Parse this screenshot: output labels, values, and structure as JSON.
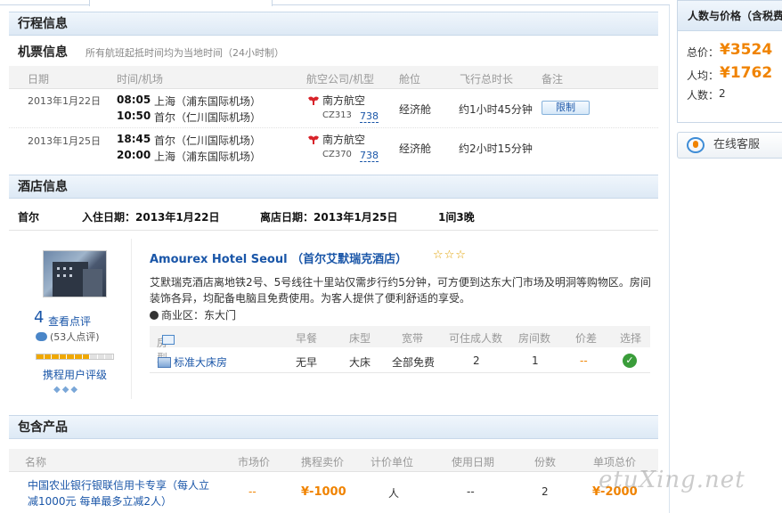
{
  "itinerary": {
    "section_title": "行程信息",
    "flight_title": "机票信息",
    "flight_note": "所有航班起抵时间均为当地时间（24小时制）",
    "columns": [
      "日期",
      "时间/机场",
      "航空公司/机型",
      "舱位",
      "飞行总时长",
      "备注"
    ],
    "flights": [
      {
        "date": "2013年1月22日",
        "dep_time": "08:05",
        "dep_airport": "上海（浦东国际机场）",
        "arr_time": "10:50",
        "arr_airport": "首尔（仁川国际机场）",
        "airline": "南方航空",
        "flight_no": "CZ313",
        "aircraft": "738",
        "cabin": "经济舱",
        "duration": "约1小时45分钟",
        "remark": "限制"
      },
      {
        "date": "2013年1月25日",
        "dep_time": "18:45",
        "dep_airport": "首尔（仁川国际机场）",
        "arr_time": "20:00",
        "arr_airport": "上海（浦东国际机场）",
        "airline": "南方航空",
        "flight_no": "CZ370",
        "aircraft": "738",
        "cabin": "经济舱",
        "duration": "约2小时15分钟",
        "remark": ""
      }
    ]
  },
  "hotel": {
    "section_title": "酒店信息",
    "city": "首尔",
    "checkin": "入住日期：2013年1月22日",
    "checkout": "离店日期：2013年1月25日",
    "nights": "1间3晚",
    "name": "Amourex Hotel Seoul （首尔艾默瑞克酒店）",
    "stars": "☆☆☆",
    "description_line1": "艾默瑞克酒店离地铁2号、5号线往十里站仅需步行约5分钟，可方便到达东大门市场及明洞等购物区。房间",
    "description_line2": "装饰各异，均配备电脑且免费使用。为客人提供了便利舒适的享受。",
    "district": "商业区：东大门",
    "score": "4",
    "review_link": "查看点评",
    "review_count": "(53人点评)",
    "rating_label": "携程用户评级",
    "rating_level": 0.7,
    "room_columns": [
      "房型",
      "早餐",
      "床型",
      "宽带",
      "可住成人数",
      "房间数",
      "价差",
      "选择"
    ],
    "room": {
      "type": "标准大床房",
      "breakfast": "无早",
      "bed": "大床",
      "broadband": "全部免费",
      "adults": "2",
      "rooms": "1",
      "price_diff": "--"
    }
  },
  "products": {
    "section_title": "包含产品",
    "columns": [
      "名称",
      "市场价",
      "携程卖价",
      "计价单位",
      "使用日期",
      "份数",
      "单项总价"
    ],
    "items": [
      {
        "name_line1": "中国农业银行银联信用卡专享（每人立",
        "name_line2": "减1000元 每单最多立减2人）",
        "market_price": "--",
        "price": "¥-1000",
        "unit": "人",
        "date": "--",
        "count": "2",
        "total": "¥-2000"
      }
    ]
  },
  "sidebar": {
    "title": "人数与价格（含税费）",
    "total_label": "总价：",
    "total_value": "¥3524",
    "per_label": "人均：",
    "per_value": "¥1762",
    "people_label": "人数：",
    "people_value": "2",
    "service_label": "在线客服"
  },
  "watermark": "etuXing.net",
  "colors": {
    "accent": "#f08300",
    "link": "#1a56a8",
    "header_bg": "#dde9f5"
  }
}
